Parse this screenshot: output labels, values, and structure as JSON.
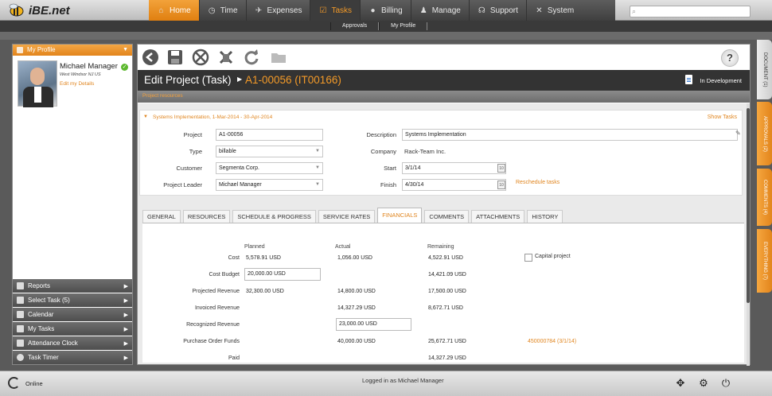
{
  "app": {
    "logo": "iBE.net"
  },
  "nav": [
    {
      "label": "Home",
      "icon": "home-icon"
    },
    {
      "label": "Time",
      "icon": "clock-icon"
    },
    {
      "label": "Expenses",
      "icon": "plane-icon"
    },
    {
      "label": "Tasks",
      "icon": "checkbox-icon"
    },
    {
      "label": "Billing",
      "icon": "piggy-bank-icon"
    },
    {
      "label": "Manage",
      "icon": "people-icon"
    },
    {
      "label": "Support",
      "icon": "headset-icon"
    },
    {
      "label": "System",
      "icon": "tools-icon"
    }
  ],
  "subnav": [
    "Approvals",
    "My Profile"
  ],
  "profile": {
    "header": "My Profile",
    "name": "Michael Manager",
    "location": "West Windsor NJ US",
    "edit": "Edit my Details"
  },
  "sidemenu": [
    "Reports",
    "Select Task (5)",
    "Calendar",
    "My Tasks",
    "Attendance Clock",
    "Task Timer"
  ],
  "page": {
    "title": "Edit Project (Task)",
    "code": "A1-00056 (IT00166)",
    "status": "In Development",
    "subhead": "Project resources"
  },
  "section": {
    "title": "Systems Implementation, 1-Mar-2014 - 30-Apr-2014",
    "show_tasks": "Show Tasks"
  },
  "form": {
    "project_label": "Project",
    "project": "A1-00056",
    "type_label": "Type",
    "type": "billable",
    "customer_label": "Customer",
    "customer": "Segmenta Corp.",
    "leader_label": "Project Leader",
    "leader": "Michael Manager",
    "description_label": "Description",
    "description": "Systems Implementation",
    "company_label": "Company",
    "company": "Rack-Team Inc.",
    "start_label": "Start",
    "start": "3/1/14",
    "finish_label": "Finish",
    "finish": "4/30/14",
    "reschedule": "Reschedule tasks"
  },
  "tabs": [
    "GENERAL",
    "RESOURCES",
    "SCHEDULE & PROGRESS",
    "SERVICE RATES",
    "FINANCIALS",
    "COMMENTS",
    "ATTACHMENTS",
    "HISTORY"
  ],
  "financials": {
    "headers": {
      "planned": "Planned",
      "actual": "Actual",
      "remaining": "Remaining"
    },
    "capital": "Capital project",
    "po_link": "450000784 (3/1/14)",
    "rows": [
      {
        "label": "Cost",
        "planned": "5,578.91 USD",
        "actual": "1,056.00 USD",
        "remaining": "4,522.91 USD"
      },
      {
        "label": "Cost Budget",
        "planned": "20,000.00 USD",
        "actual": "",
        "remaining": "14,421.09 USD"
      },
      {
        "label": "Projected Revenue",
        "planned": "32,300.00 USD",
        "actual": "14,800.00 USD",
        "remaining": "17,500.00 USD"
      },
      {
        "label": "Invoiced Revenue",
        "planned": "",
        "actual": "14,327.29 USD",
        "remaining": "8,672.71 USD"
      },
      {
        "label": "Recognized Revenue",
        "planned": "",
        "actual": "23,000.00 USD",
        "remaining": ""
      },
      {
        "label": "Purchase Order Funds",
        "planned": "",
        "actual": "40,000.00 USD",
        "remaining": "25,672.71 USD"
      },
      {
        "label": "Paid",
        "planned": "",
        "actual": "",
        "remaining": "14,327.29 USD"
      }
    ]
  },
  "righttabs": [
    "DOCUMENT (1)",
    "APPROVALS (2)",
    "COMMENTS (4)",
    "EVERYTHING (7)"
  ],
  "footer": {
    "online": "Online",
    "logged": "Logged in as Michael Manager"
  }
}
